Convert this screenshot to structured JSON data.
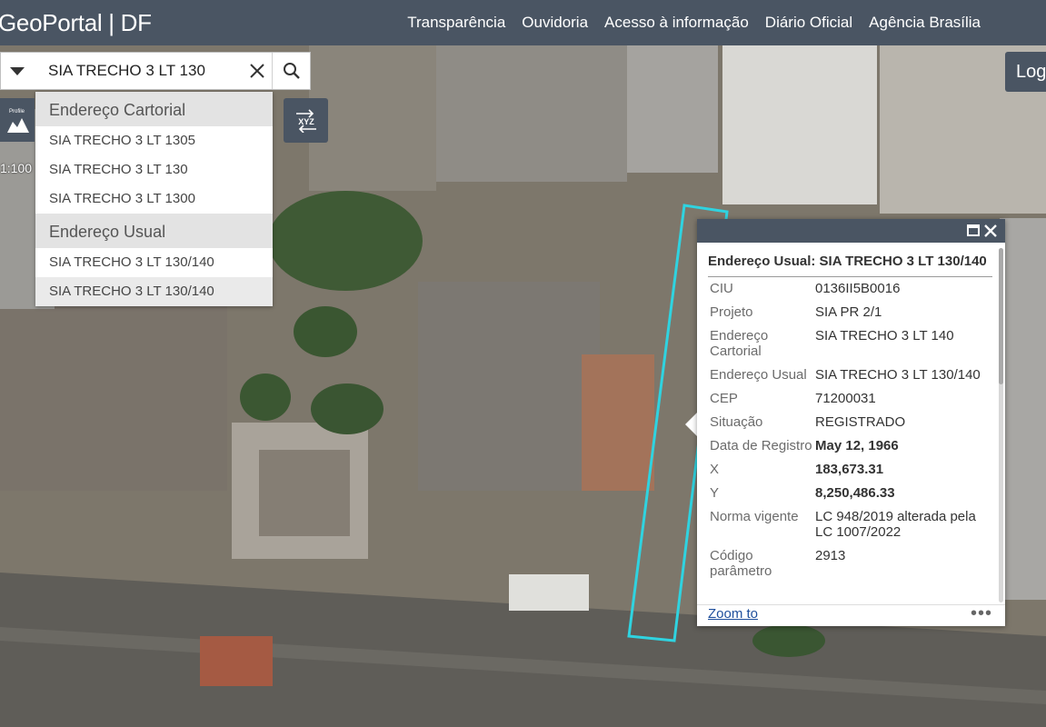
{
  "header": {
    "brand": "GeoPortal | DF",
    "nav": [
      "Transparência",
      "Ouvidoria",
      "Acesso à informação",
      "Diário Oficial",
      "Agência Brasília"
    ],
    "login_label": "Log"
  },
  "search": {
    "value": "SIA TRECHO 3 LT 130"
  },
  "suggestions": {
    "groups": [
      {
        "header": "Endereço Cartorial",
        "items": [
          "SIA TRECHO 3 LT 1305",
          "SIA TRECHO 3 LT 130",
          "SIA TRECHO 3 LT 1300"
        ]
      },
      {
        "header": "Endereço Usual",
        "items": [
          "SIA TRECHO 3 LT 130/140",
          "SIA TRECHO 3 LT 130/140"
        ]
      }
    ]
  },
  "tools": {
    "profile_label": "Profile",
    "scale": "1:100",
    "xyz_label": "XYZ"
  },
  "popup": {
    "title": "Endereço Usual: SIA TRECHO 3 LT 130/140",
    "attributes": [
      {
        "label": "CIU",
        "value": "0136II5B0016"
      },
      {
        "label": "Projeto",
        "value": "SIA PR 2/1"
      },
      {
        "label": "Endereço Cartorial",
        "value": "SIA TRECHO 3 LT 140"
      },
      {
        "label": "Endereço Usual",
        "value": "SIA TRECHO 3 LT 130/140"
      },
      {
        "label": "CEP",
        "value": "71200031"
      },
      {
        "label": "Situação",
        "value": "REGISTRADO"
      },
      {
        "label": "Data de Registro",
        "value": "May 12, 1966"
      },
      {
        "label": "X",
        "value": "183,673.31"
      },
      {
        "label": "Y",
        "value": "8,250,486.33"
      },
      {
        "label": "Norma vigente",
        "value": "LC 948/2019 alterada pela LC 1007/2022"
      },
      {
        "label": "Código parâmetro",
        "value": "2913"
      }
    ],
    "zoom_to": "Zoom to",
    "more": "•••"
  },
  "colors": {
    "header_bg": "#4a5563",
    "parcel_outline": "#2fd3e0",
    "link": "#1f4f9c"
  }
}
